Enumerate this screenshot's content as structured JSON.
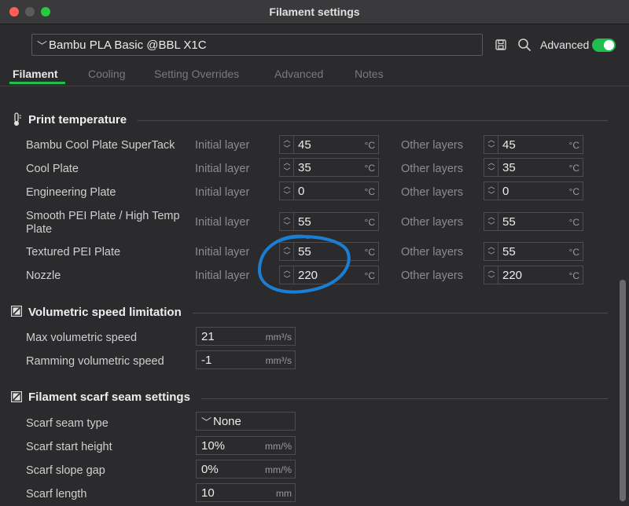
{
  "window": {
    "title": "Filament settings"
  },
  "header": {
    "preset_value": "Bambu PLA Basic @BBL X1C",
    "advanced_label": "Advanced",
    "advanced_on": true
  },
  "tabs": [
    {
      "label": "Filament",
      "active": true
    },
    {
      "label": "Cooling",
      "active": false
    },
    {
      "label": "Setting Overrides",
      "active": false
    },
    {
      "label": "Advanced",
      "active": false
    },
    {
      "label": "Notes",
      "active": false
    }
  ],
  "print_temperature": {
    "title": "Print temperature",
    "initial_label": "Initial layer",
    "other_label": "Other layers",
    "unit": "°C",
    "rows": [
      {
        "label": "Bambu Cool Plate SuperTack",
        "initial": "45",
        "other": "45"
      },
      {
        "label": "Cool Plate",
        "initial": "35",
        "other": "35"
      },
      {
        "label": "Engineering Plate",
        "initial": "0",
        "other": "0"
      },
      {
        "label_line1": "Smooth PEI Plate / High Temp",
        "label_line2": "Plate",
        "initial": "55",
        "other": "55"
      },
      {
        "label": "Textured PEI Plate",
        "initial": "55",
        "other": "55"
      },
      {
        "label": "Nozzle",
        "initial": "220",
        "other": "220"
      }
    ]
  },
  "volumetric": {
    "title": "Volumetric speed limitation",
    "rows": [
      {
        "label": "Max volumetric speed",
        "value": "21",
        "unit": "mm³/s"
      },
      {
        "label": "Ramming volumetric speed",
        "value": "-1",
        "unit": "mm³/s"
      }
    ]
  },
  "scarf": {
    "title": "Filament scarf seam settings",
    "type_label": "Scarf seam type",
    "type_value": "None",
    "rows": [
      {
        "label": "Scarf start height",
        "value": "10%",
        "unit": "mm/%"
      },
      {
        "label": "Scarf slope gap",
        "value": "0%",
        "unit": "mm/%"
      },
      {
        "label": "Scarf length",
        "value": "10",
        "unit": "mm"
      }
    ]
  },
  "colors": {
    "accent": "#1fbf4e",
    "annotation": "#1a7fd4"
  }
}
